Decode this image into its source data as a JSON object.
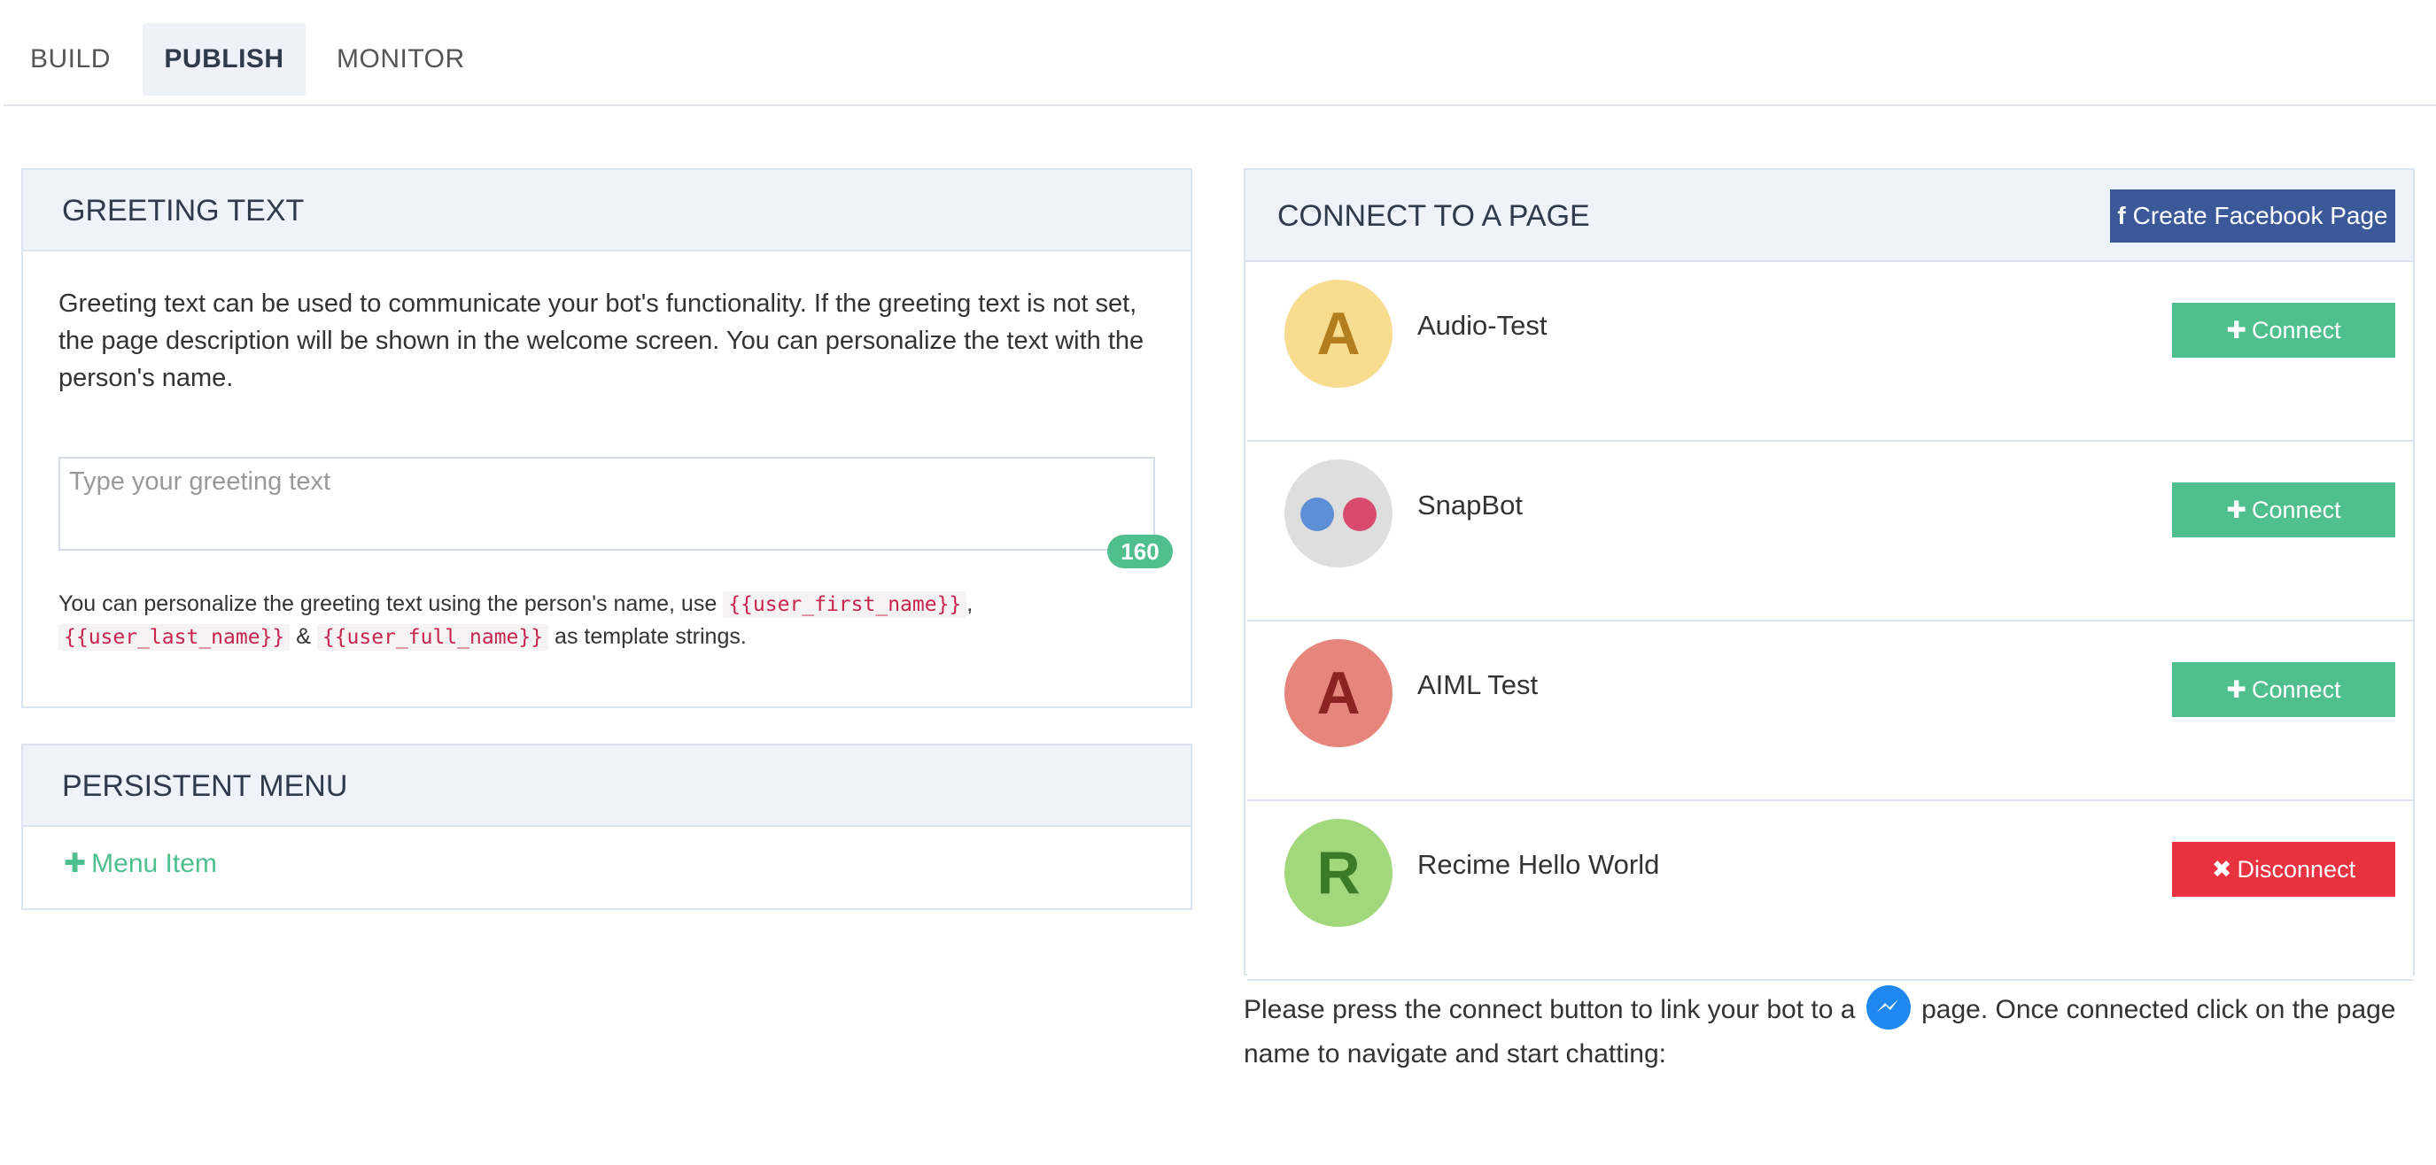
{
  "nav": {
    "tabs": [
      {
        "label": "BUILD"
      },
      {
        "label": "PUBLISH",
        "active": true
      },
      {
        "label": "MONITOR"
      }
    ]
  },
  "greeting": {
    "title": "GREETING TEXT",
    "description": "Greeting text can be used to communicate your bot's functionality. If the greeting text is not set, the page description will be shown in the welcome screen. You can personalize the text with the person's name.",
    "input_placeholder": "Type your greeting text",
    "input_value": "",
    "char_counter": "160",
    "help_prefix": "You can personalize the greeting text using the person's name, use",
    "tpl_first": "{{user_first_name}}",
    "help_comma": ",",
    "tpl_last": "{{user_last_name}}",
    "help_amp": "&",
    "tpl_full": "{{user_full_name}}",
    "help_suffix": "as template strings."
  },
  "persistent_menu": {
    "title": "PERSISTENT MENU",
    "add_label": "Menu Item",
    "add_icon": "plus-icon"
  },
  "connect": {
    "title": "CONNECT TO A PAGE",
    "create_fb_label": "Create Facebook Page",
    "create_fb_icon": "facebook-icon",
    "pages": [
      {
        "name": "Audio-Test",
        "avatar_letter": "A",
        "button": "Connect",
        "state": "disconnected"
      },
      {
        "name": "SnapBot",
        "avatar_letter": "",
        "button": "Connect",
        "state": "disconnected"
      },
      {
        "name": "AIML Test",
        "avatar_letter": "A",
        "button": "Connect",
        "state": "disconnected"
      },
      {
        "name": "Recime Hello World",
        "avatar_letter": "R",
        "button": "Disconnect",
        "state": "connected"
      }
    ],
    "note_before": "Please press the connect button to link your bot to a",
    "note_after": "page. Once connected click on the page name to navigate and start chatting:",
    "note_icon": "messenger-icon"
  },
  "colors": {
    "accent_green": "#4fc08d",
    "facebook_blue": "#3b5998",
    "danger_red": "#e8323f",
    "panel_header_bg": "#eef2f9"
  }
}
